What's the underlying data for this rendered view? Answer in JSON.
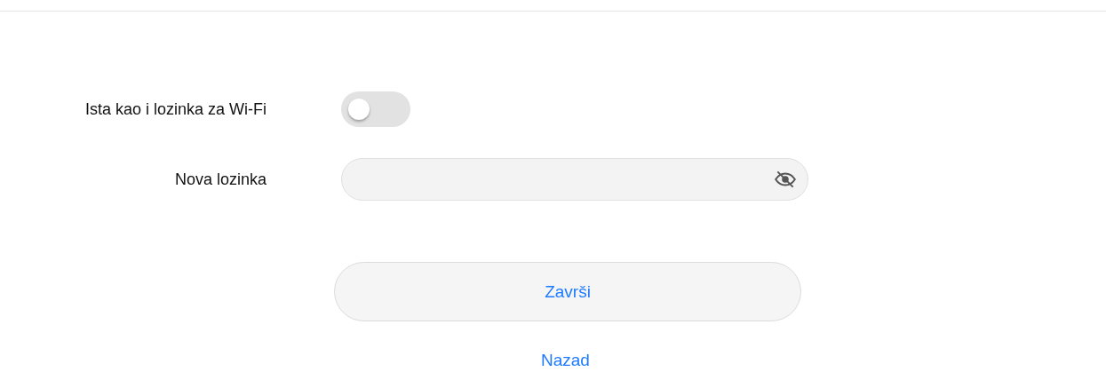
{
  "same_as_wifi": {
    "label": "Ista kao i lozinka za Wi-Fi",
    "on": false
  },
  "new_password": {
    "label": "Nova lozinka",
    "masked": true
  },
  "finish_button": "Završi",
  "back_link": "Nazad"
}
